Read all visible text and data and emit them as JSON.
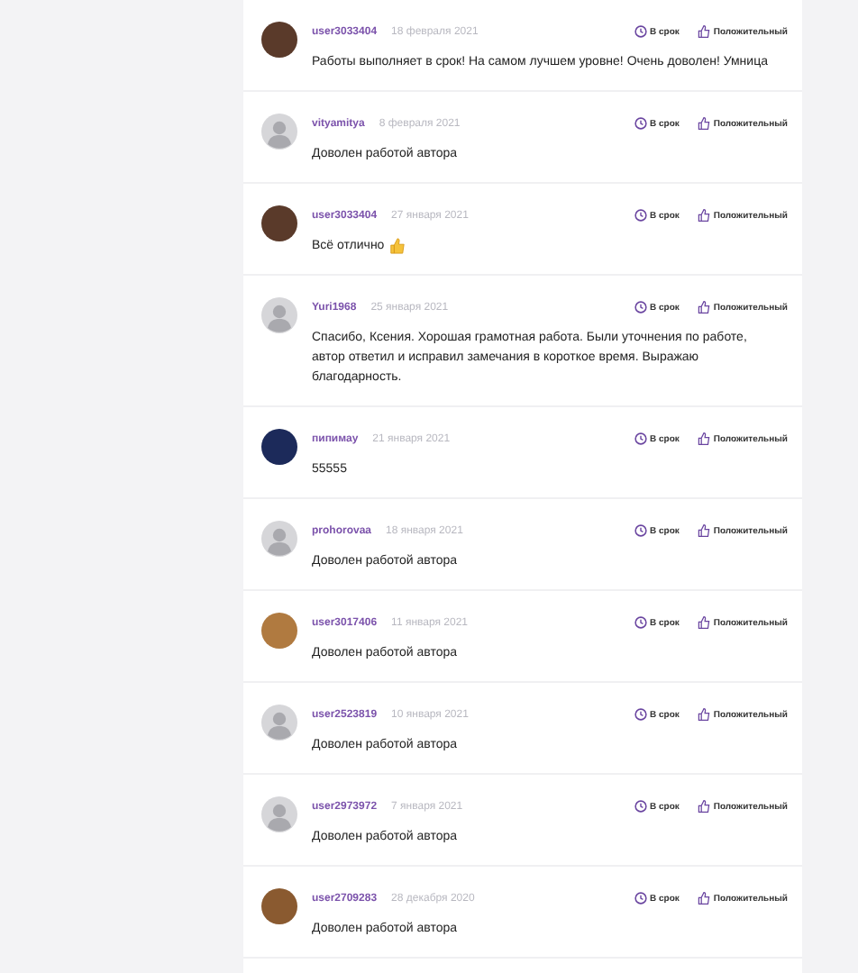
{
  "reviews": [
    {
      "author": "user3033404",
      "date": "18 февраля 2021",
      "avatar": {
        "kind": "custom",
        "color": "#5a3a2a"
      },
      "deadline": "В срок",
      "rating": "Положительный",
      "text": "Работы выполняет в срок! На самом лучшем уровне! Очень доволен! Умница"
    },
    {
      "author": "vityamitya",
      "date": "8 февраля 2021",
      "avatar": {
        "kind": "default"
      },
      "deadline": "В срок",
      "rating": "Положительный",
      "text": "Доволен работой автора"
    },
    {
      "author": "user3033404",
      "date": "27 января 2021",
      "avatar": {
        "kind": "custom",
        "color": "#5a3a2a"
      },
      "deadline": "В срок",
      "rating": "Положительный",
      "text": "Всё отлично",
      "thumb": true
    },
    {
      "author": "Yuri1968",
      "date": "25 января 2021",
      "avatar": {
        "kind": "default"
      },
      "deadline": "В срок",
      "rating": "Положительный",
      "text": "Спасибо, Ксения. Хорошая грамотная работа. Были уточнения по работе, автор ответил и исправил замечания в короткое время. Выражаю благодарность."
    },
    {
      "author": "пипимау",
      "date": "21 января 2021",
      "avatar": {
        "kind": "custom",
        "color": "#1c2a5a"
      },
      "deadline": "В срок",
      "rating": "Положительный",
      "text": "55555"
    },
    {
      "author": "prohorovaa",
      "date": "18 января 2021",
      "avatar": {
        "kind": "default"
      },
      "deadline": "В срок",
      "rating": "Положительный",
      "text": "Доволен работой автора"
    },
    {
      "author": "user3017406",
      "date": "11 января 2021",
      "avatar": {
        "kind": "custom",
        "color": "#b07a40"
      },
      "deadline": "В срок",
      "rating": "Положительный",
      "text": "Доволен работой автора"
    },
    {
      "author": "user2523819",
      "date": "10 января 2021",
      "avatar": {
        "kind": "default"
      },
      "deadline": "В срок",
      "rating": "Положительный",
      "text": "Доволен работой автора"
    },
    {
      "author": "user2973972",
      "date": "7 января 2021",
      "avatar": {
        "kind": "default"
      },
      "deadline": "В срок",
      "rating": "Положительный",
      "text": "Доволен работой автора"
    },
    {
      "author": "user2709283",
      "date": "28 декабря 2020",
      "avatar": {
        "kind": "custom",
        "color": "#8a5a30"
      },
      "deadline": "В срок",
      "rating": "Положительный",
      "text": "Доволен работой автора"
    }
  ]
}
